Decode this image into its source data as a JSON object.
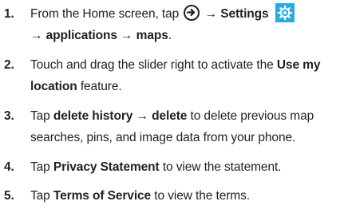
{
  "steps": [
    {
      "number": "1.",
      "line1_prefix": "From the Home screen, tap ",
      "arrow_symbol": "→",
      "settings_label": "Settings",
      "line2": "→ applications → maps",
      "line2_suffix": "."
    },
    {
      "number": "2.",
      "line1": "Touch and drag the slider right to activate the ",
      "bold1": "Use my",
      "bold2": "location",
      "line2_suffix": " feature."
    },
    {
      "number": "3.",
      "prefix": "Tap ",
      "bold": "delete history → delete",
      "line1_suffix": " to delete previous map",
      "line2": "searches, pins, and image data from your phone."
    },
    {
      "number": "4.",
      "prefix": "Tap ",
      "bold": "Privacy Statement",
      "suffix": " to view the statement."
    },
    {
      "number": "5.",
      "prefix": "Tap ",
      "bold": "Terms of Service",
      "suffix": " to view the terms."
    }
  ],
  "icons": {
    "arrow": "circle-arrow-right-icon",
    "settings": "settings-gear-icon"
  },
  "colors": {
    "text": "#231f20",
    "settings_tile": "#29abe2"
  }
}
